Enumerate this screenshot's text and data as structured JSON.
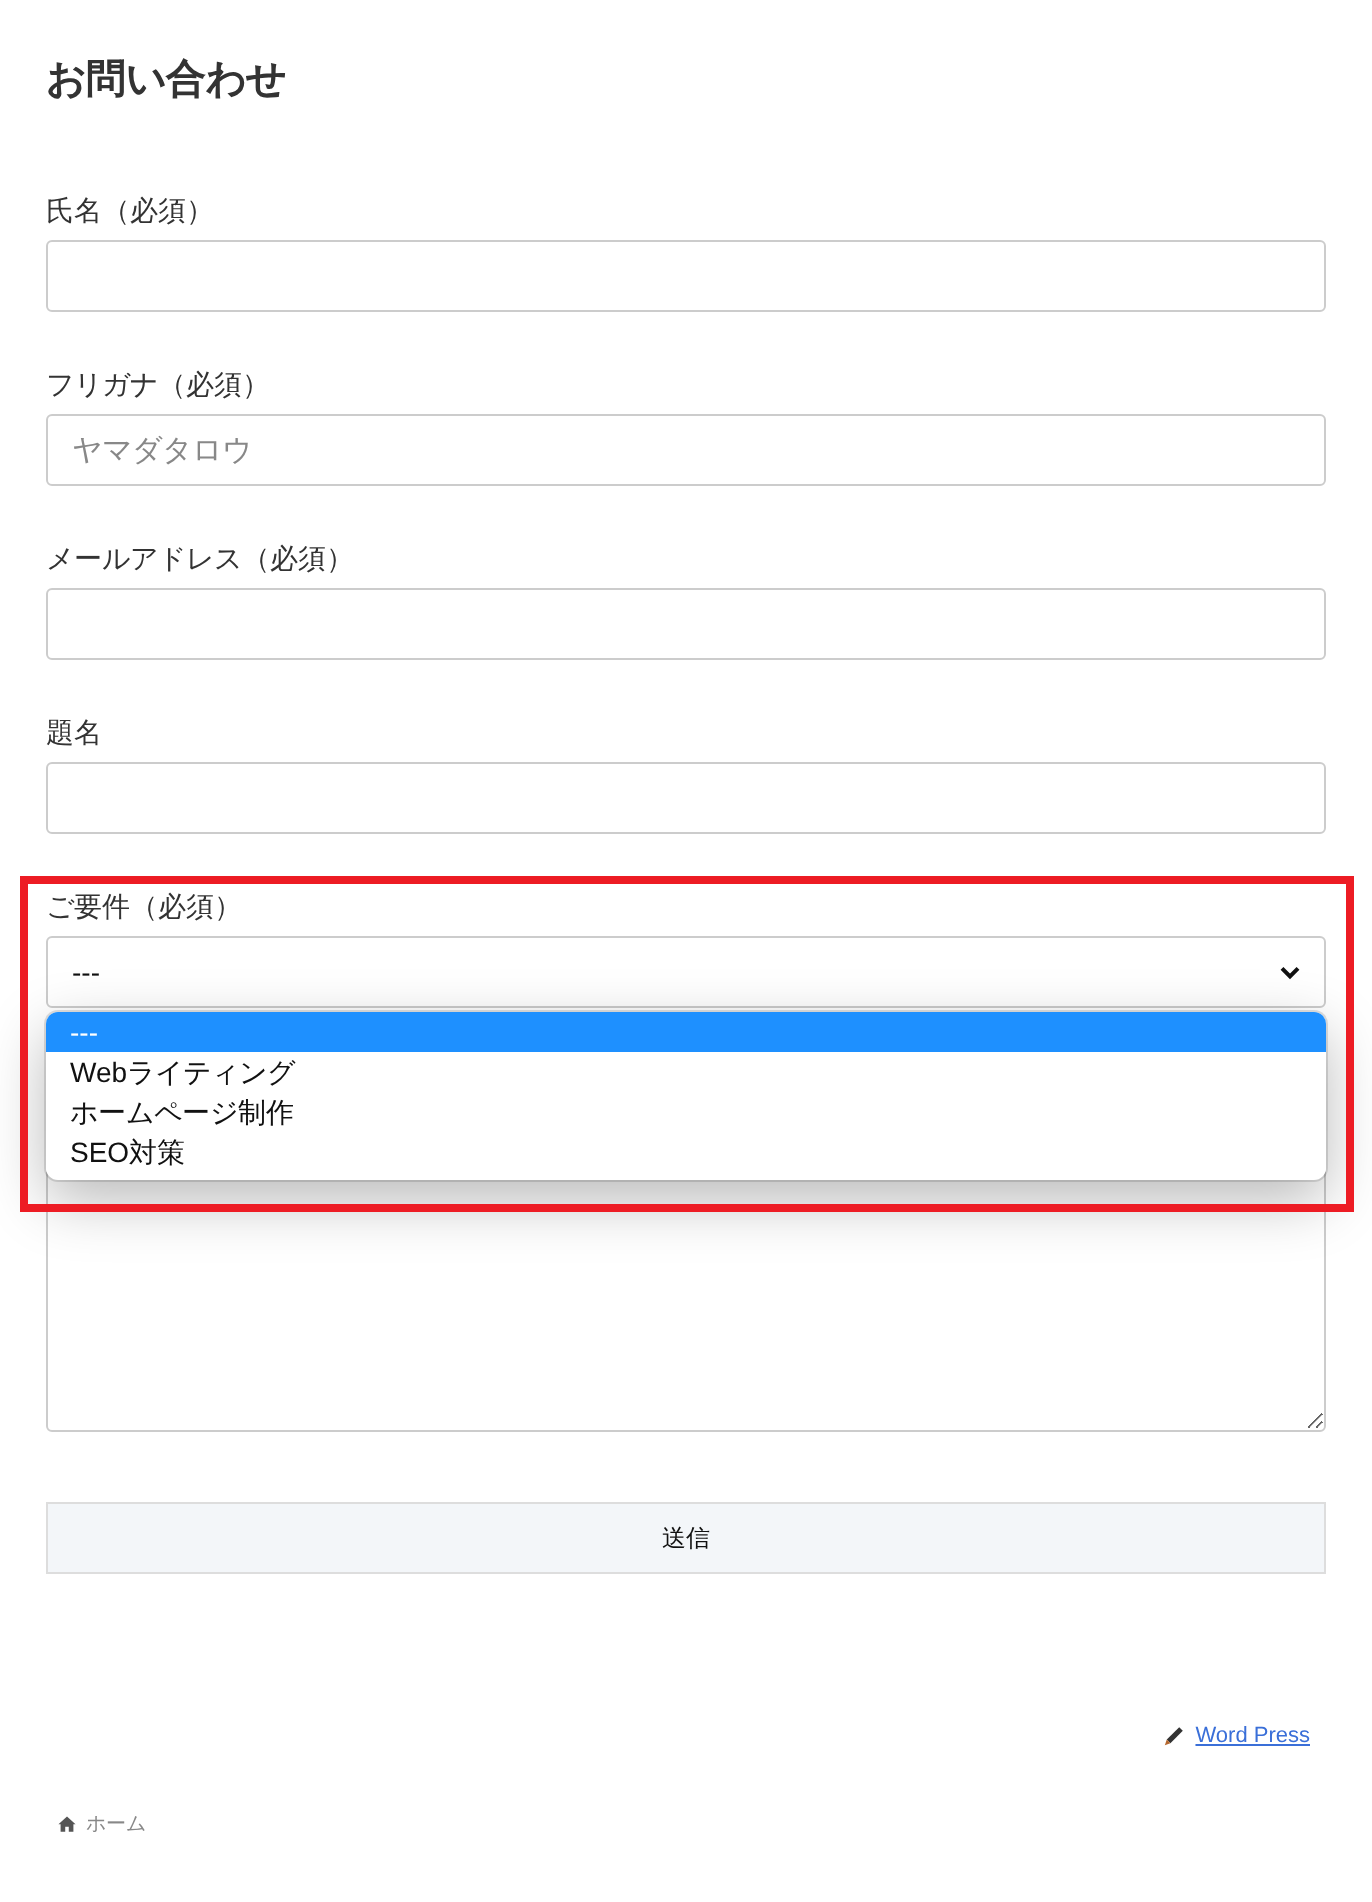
{
  "page": {
    "title": "お問い合わせ"
  },
  "form": {
    "fields": [
      {
        "kind": "input",
        "label": "氏名（必須）"
      },
      {
        "kind": "input",
        "label": "フリガナ（必須）",
        "placeholder": "ヤマダタロウ"
      },
      {
        "kind": "input",
        "label": "メールアドレス（必須）"
      },
      {
        "kind": "input",
        "label": "題名"
      },
      {
        "kind": "select",
        "label": "ご要件（必須）",
        "value": "---",
        "expanded": true,
        "highlighted": true,
        "options": [
          {
            "label": "---",
            "selected": true
          },
          {
            "label": "Webライティング",
            "selected": false
          },
          {
            "label": "ホームページ制作",
            "selected": false
          },
          {
            "label": "SEO対策",
            "selected": false
          }
        ]
      },
      {
        "kind": "textarea"
      }
    ],
    "submit": "送信"
  },
  "footer": {
    "edit_link": "Word Press"
  },
  "breadcrumb": [
    {
      "label": "ホーム"
    }
  ]
}
